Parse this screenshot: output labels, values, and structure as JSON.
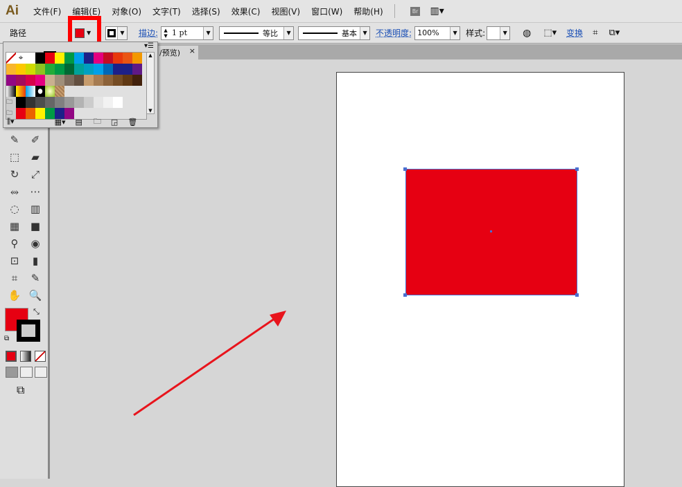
{
  "app": {
    "logo": "Ai"
  },
  "menu": [
    "文件(F)",
    "编辑(E)",
    "对象(O)",
    "文字(T)",
    "选择(S)",
    "效果(C)",
    "视图(V)",
    "窗口(W)",
    "帮助(H)"
  ],
  "menu_icons": {
    "bridge": "Br",
    "layout": "▥▾"
  },
  "control": {
    "object_type": "路径",
    "stroke_label": "描边:",
    "stroke_weight": "1 pt",
    "profile_label": "等比",
    "brush_label": "基本",
    "opacity_label": "不透明度:",
    "opacity_value": "100%",
    "style_label": "样式:",
    "transform_label": "变换"
  },
  "document_tab": {
    "title": "/预览)",
    "close": "×"
  },
  "colors": {
    "fill": "#e60012",
    "selection": "#4a6fd0",
    "highlight": "#ff0000"
  },
  "swatches": {
    "rows": [
      [
        "none",
        "reg",
        "#ffffff",
        "#000000",
        "#e60012",
        "#fff100",
        "#009944",
        "#00a0e9",
        "#1d2088",
        "#e4007f",
        "#c30d23",
        "#e8380d",
        "#ea5514",
        "#f39800"
      ],
      [
        "#f8b62d",
        "#fcc800",
        "#cfdb00",
        "#8fc31f",
        "#22ac38",
        "#009944",
        "#006934",
        "#00a29a",
        "#00a0c1",
        "#00a0e9",
        "#0068b7",
        "#1d2088",
        "#1d2088",
        "#601986"
      ],
      [
        "#920783",
        "#a40b5d",
        "#d7004a",
        "#e4007f",
        "#c9b08f",
        "#a08f7a",
        "#7d6b5c",
        "#634f40",
        "#c69c6d",
        "#a67c52",
        "#8c6239",
        "#754c24",
        "#603813",
        "#42210b"
      ],
      [
        "grad-bw",
        "grad-yo",
        "grad-blue",
        "pat-dot",
        "pat-green",
        "pat-brown"
      ],
      [
        "folder",
        "#000000",
        "#333333",
        "#4d4d4d",
        "#666666",
        "#808080",
        "#999999",
        "#b3b3b3",
        "#cccccc",
        "#e6e6e6",
        "#f2f2f2",
        "#ffffff"
      ],
      [
        "folder",
        "#e60012",
        "#eb6100",
        "#fff100",
        "#009944",
        "#1d2088",
        "#920783"
      ]
    ]
  },
  "tools": [
    "✎",
    "✐",
    "⬚",
    "▰",
    "↻",
    "⤢",
    "⥈",
    "⋯",
    "◌",
    "▥",
    "▦",
    "■",
    "⚲",
    "◉",
    "⊡",
    "▮",
    "⌗",
    "✎",
    "✋",
    "🔍"
  ]
}
